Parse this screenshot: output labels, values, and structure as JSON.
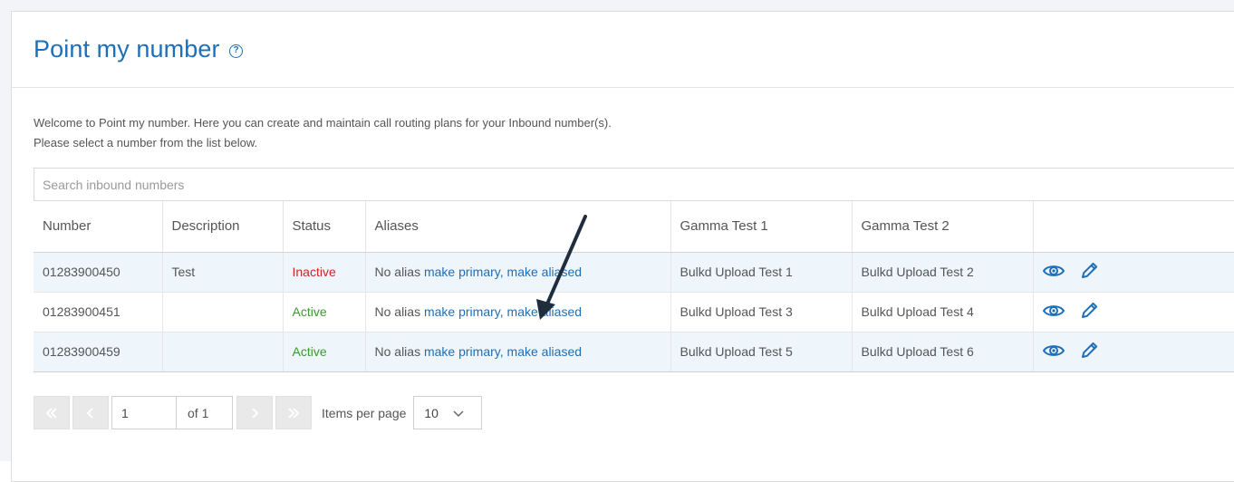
{
  "page": {
    "title": "Point my number",
    "intro_line1": "Welcome to Point my number. Here you can create and maintain call routing plans for your Inbound number(s).",
    "intro_line2": "Please select a number from the list below."
  },
  "search": {
    "placeholder": "Search inbound numbers",
    "value": ""
  },
  "table": {
    "headers": [
      "Number",
      "Description",
      "Status",
      "Aliases",
      "Gamma Test 1",
      "Gamma Test 2",
      ""
    ],
    "rows": [
      {
        "number": "01283900450",
        "description": "Test",
        "status": "Inactive",
        "alias_text": "No alias",
        "make_primary": "make primary",
        "separator": ",",
        "make_aliased": "make aliased",
        "gamma1": "Bulkd Upload Test 1",
        "gamma2": "Bulkd Upload Test 2"
      },
      {
        "number": "01283900451",
        "description": "",
        "status": "Active",
        "alias_text": "No alias",
        "make_primary": "make primary",
        "separator": ",",
        "make_aliased": "make aliased",
        "gamma1": "Bulkd Upload Test 3",
        "gamma2": "Bulkd Upload Test 4"
      },
      {
        "number": "01283900459",
        "description": "",
        "status": "Active",
        "alias_text": "No alias",
        "make_primary": "make primary",
        "separator": ",",
        "make_aliased": "make aliased",
        "gamma1": "Bulkd Upload Test 5",
        "gamma2": "Bulkd Upload Test 6"
      }
    ],
    "row_icons": [
      "eye-icon",
      "pencil-icon"
    ]
  },
  "pager": {
    "current_page": "1",
    "of_label": "of 1",
    "items_per_page_label": "Items per page",
    "items_per_page_value": "10"
  },
  "colors": {
    "title": "#1d6fb8",
    "link": "#1d6fb8",
    "inactive": "#d0232b",
    "active": "#3a9a2e",
    "row_alt": "#eef5fb"
  }
}
